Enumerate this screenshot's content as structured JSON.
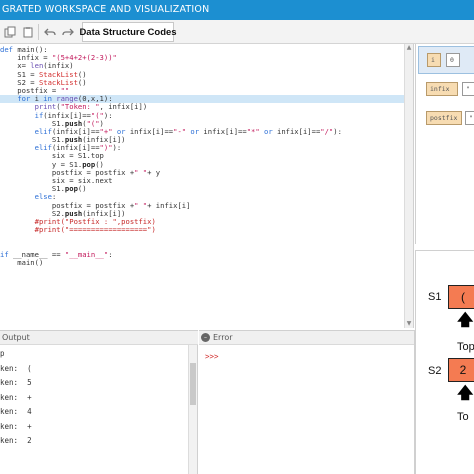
{
  "app": {
    "title": "GRATED WORKSPACE AND VISUALIZATION"
  },
  "toolbar": {
    "ds_button_label": "Data Structure Codes",
    "icons": [
      "copy-icon",
      "paste-icon",
      "undo-icon",
      "redo-icon",
      "run-icon"
    ]
  },
  "editor": {
    "lines": [
      {
        "parts": [
          {
            "t": "def ",
            "c": "kw"
          },
          {
            "t": "main():",
            "c": ""
          }
        ]
      },
      {
        "parts": [
          {
            "t": "    infix = ",
            "c": ""
          },
          {
            "t": "\"(5+4+2+(2-3))\"",
            "c": "str"
          }
        ]
      },
      {
        "parts": [
          {
            "t": "    x= ",
            "c": ""
          },
          {
            "t": "len",
            "c": "fn"
          },
          {
            "t": "(infix)",
            "c": ""
          }
        ]
      },
      {
        "parts": [
          {
            "t": "    S1 = ",
            "c": ""
          },
          {
            "t": "StackList",
            "c": "red"
          },
          {
            "t": "()",
            "c": ""
          }
        ]
      },
      {
        "parts": [
          {
            "t": "    S2 = ",
            "c": ""
          },
          {
            "t": "StackList",
            "c": "red"
          },
          {
            "t": "()",
            "c": ""
          }
        ]
      },
      {
        "parts": [
          {
            "t": "    postfix = ",
            "c": ""
          },
          {
            "t": "\"\"",
            "c": "str"
          }
        ]
      },
      {
        "parts": [
          {
            "t": "    ",
            "c": ""
          },
          {
            "t": "for ",
            "c": "kw"
          },
          {
            "t": "i ",
            "c": ""
          },
          {
            "t": "in ",
            "c": "kw"
          },
          {
            "t": "range",
            "c": "fn"
          },
          {
            "t": "(0,x,1):",
            "c": ""
          }
        ],
        "hl": true
      },
      {
        "parts": [
          {
            "t": "        ",
            "c": ""
          },
          {
            "t": "print",
            "c": "fn"
          },
          {
            "t": "(",
            "c": ""
          },
          {
            "t": "\"Token: \"",
            "c": "str"
          },
          {
            "t": ", infix[i])",
            "c": ""
          }
        ]
      },
      {
        "parts": [
          {
            "t": "        ",
            "c": ""
          },
          {
            "t": "if",
            "c": "kw"
          },
          {
            "t": "(infix[i]==",
            "c": ""
          },
          {
            "t": "\"(\"",
            "c": "str"
          },
          {
            "t": "):",
            "c": ""
          }
        ]
      },
      {
        "parts": [
          {
            "t": "            S1.",
            "c": ""
          },
          {
            "t": "push",
            "c": "bold"
          },
          {
            "t": "(",
            "c": ""
          },
          {
            "t": "\"(\"",
            "c": "str"
          },
          {
            "t": ")",
            "c": ""
          }
        ]
      },
      {
        "parts": [
          {
            "t": "        ",
            "c": ""
          },
          {
            "t": "elif",
            "c": "kw"
          },
          {
            "t": "(infix[i]==",
            "c": ""
          },
          {
            "t": "\"+\"",
            "c": "str"
          },
          {
            "t": " or ",
            "c": "kw"
          },
          {
            "t": "infix[i]==",
            "c": ""
          },
          {
            "t": "\"-\"",
            "c": "str"
          },
          {
            "t": " or ",
            "c": "kw"
          },
          {
            "t": "infix[i]==",
            "c": ""
          },
          {
            "t": "\"*\"",
            "c": "str"
          },
          {
            "t": " or ",
            "c": "kw"
          },
          {
            "t": "infix[i]==",
            "c": ""
          },
          {
            "t": "\"/\"",
            "c": "str"
          },
          {
            "t": "):",
            "c": ""
          }
        ]
      },
      {
        "parts": [
          {
            "t": "            S1.",
            "c": ""
          },
          {
            "t": "push",
            "c": "bold"
          },
          {
            "t": "(infix[i])",
            "c": ""
          }
        ]
      },
      {
        "parts": [
          {
            "t": "        ",
            "c": ""
          },
          {
            "t": "elif",
            "c": "kw"
          },
          {
            "t": "(infix[i]==",
            "c": ""
          },
          {
            "t": "\")\"",
            "c": "str"
          },
          {
            "t": "):",
            "c": ""
          }
        ]
      },
      {
        "parts": [
          {
            "t": "            six = S1.top",
            "c": ""
          }
        ]
      },
      {
        "parts": [
          {
            "t": "            y = S1.",
            "c": ""
          },
          {
            "t": "pop",
            "c": "bold"
          },
          {
            "t": "()",
            "c": ""
          }
        ]
      },
      {
        "parts": [
          {
            "t": "            postfix = postfix +",
            "c": ""
          },
          {
            "t": "\" \"",
            "c": "str"
          },
          {
            "t": "+ y",
            "c": ""
          }
        ]
      },
      {
        "parts": [
          {
            "t": "            six = six.next",
            "c": ""
          }
        ]
      },
      {
        "parts": [
          {
            "t": "            S1.",
            "c": ""
          },
          {
            "t": "pop",
            "c": "bold"
          },
          {
            "t": "()",
            "c": ""
          }
        ]
      },
      {
        "parts": [
          {
            "t": "        ",
            "c": ""
          },
          {
            "t": "else",
            "c": "kw"
          },
          {
            "t": ":",
            "c": ""
          }
        ]
      },
      {
        "parts": [
          {
            "t": "            postfix = postfix +",
            "c": ""
          },
          {
            "t": "\" \"",
            "c": "str"
          },
          {
            "t": "+ infix[i]",
            "c": ""
          }
        ]
      },
      {
        "parts": [
          {
            "t": "            S2.",
            "c": ""
          },
          {
            "t": "push",
            "c": "bold"
          },
          {
            "t": "(infix[i])",
            "c": ""
          }
        ]
      },
      {
        "parts": [
          {
            "t": "        ",
            "c": ""
          },
          {
            "t": "#print(\"Postfix : \",postfix)",
            "c": "cmt"
          }
        ]
      },
      {
        "parts": [
          {
            "t": "        ",
            "c": ""
          },
          {
            "t": "#print(\"==================\")",
            "c": "cmt"
          }
        ]
      },
      {
        "parts": [
          {
            "t": "",
            "c": ""
          }
        ]
      },
      {
        "parts": [
          {
            "t": "",
            "c": ""
          }
        ]
      },
      {
        "parts": [
          {
            "t": "if ",
            "c": "kw"
          },
          {
            "t": "__name__ == ",
            "c": ""
          },
          {
            "t": "\"__main__\"",
            "c": "str"
          },
          {
            "t": ":",
            "c": ""
          }
        ]
      },
      {
        "parts": [
          {
            "t": "    main()",
            "c": ""
          }
        ]
      }
    ]
  },
  "right_top": {
    "chips_row1": [
      "i",
      "0"
    ],
    "chips_row2": [
      "infix",
      "\""
    ],
    "chips_row3": [
      "postfix",
      "\""
    ]
  },
  "stacks": {
    "s1": {
      "label": "S1",
      "value": "(",
      "top_label": "Top"
    },
    "s2": {
      "label": "S2",
      "value": "2",
      "top_label": "To"
    }
  },
  "output": {
    "header": "Output",
    "lines": [
      "p",
      "ken:  (",
      "ken:  5",
      "ken:  +",
      "ken:  4",
      "ken:  +",
      "ken:  2"
    ]
  },
  "error": {
    "header": "Error",
    "prompt": ">>>"
  },
  "colors": {
    "titlebar": "#1c8fd1",
    "stack_box": "#f47b52",
    "highlight_line": "#cfe6f7"
  }
}
